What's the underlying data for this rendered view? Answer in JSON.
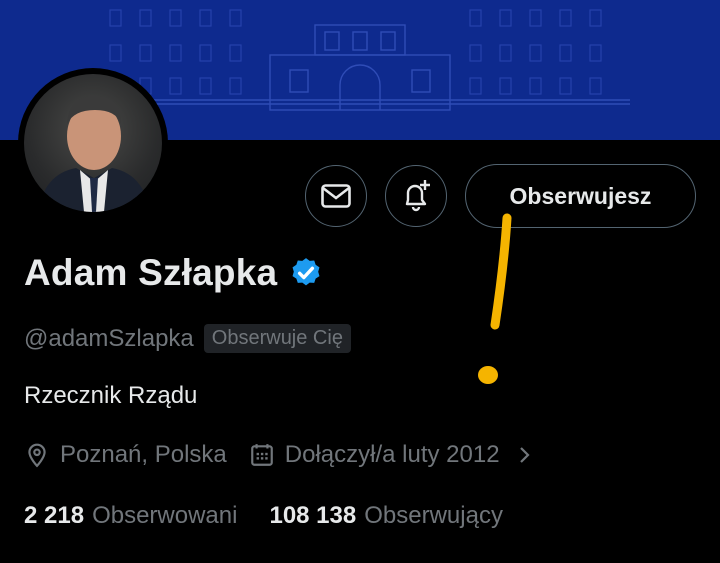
{
  "profile": {
    "name": "Adam Szłapka",
    "handle": "@adamSzlapka",
    "follows_you_badge": "Obserwuje Cię",
    "bio": "Rzecznik Rządu",
    "location": "Poznań, Polska",
    "joined": "Dołączył/a luty 2012",
    "verified": true
  },
  "actions": {
    "message_icon": "envelope-icon",
    "notify_icon": "bell-plus-icon",
    "follow_label": "Obserwujesz"
  },
  "stats": {
    "following_count": "2 218",
    "following_label": "Obserwowani",
    "followers_count": "108 138",
    "followers_label": "Obserwujący"
  },
  "colors": {
    "background": "#000000",
    "banner": "#0e2a8e",
    "verified_badge": "#1d9bf0",
    "secondary_text": "#71767b",
    "annotation": "#f5b400"
  }
}
